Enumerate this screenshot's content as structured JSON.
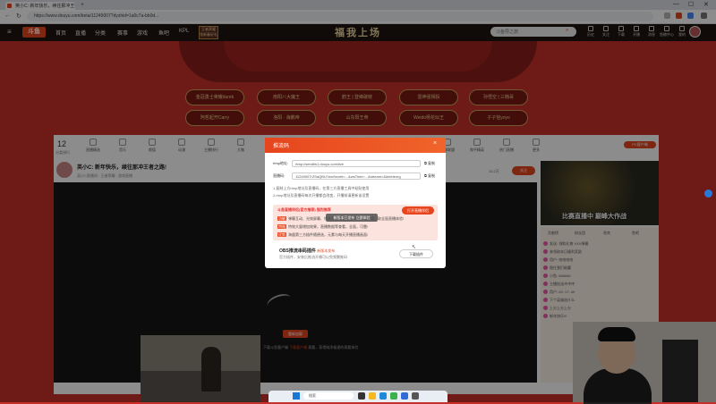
{
  "browser": {
    "tab_title": "英小C: 新年快乐，续往那冲王者之路 - 斗鱼",
    "new_tab": "+",
    "url": "https://www.douyu.com/beta/11249007?dyshid=1a0c7a-bb0d...",
    "win_controls": [
      "—",
      "☐",
      "✕"
    ]
  },
  "header": {
    "logo": "斗鱼",
    "menu_icon": "≡",
    "nav": [
      "首页",
      "直播",
      "分类",
      "赛事",
      "游戏",
      "鱼吧",
      "KPL"
    ],
    "promo": [
      "王者荣耀",
      "领新春好礼"
    ],
    "banner_title": "福我上场",
    "search_placeholder": "斗鱼导之旅",
    "icons": [
      "历史",
      "关注",
      "下载",
      "开播",
      "消息",
      "鱼粮中心",
      "我的"
    ]
  },
  "event_pills": [
    [
      "金冠勇士荣耀dumb",
      "南阳八大魔王",
      "鹤王 | 登峰破晓",
      "雷神强相投",
      "孙悟空 | 三韩哥"
    ],
    [
      "阿哲起开Carry",
      "洛阳 · 海鹏帝",
      "山东阳王帝",
      "Weido杨花似王",
      "子子恰yoyo"
    ]
  ],
  "categories": {
    "count": "12",
    "count_label": "分类排行",
    "items": [
      "直播精选",
      "音乐",
      "颜值",
      "动漫",
      "主播排行",
      "大咖",
      "娱乐",
      "赛事直播",
      "星秀",
      "相亲交友",
      "恋爱",
      "陪玩",
      "英雄联盟",
      "和平精英",
      "热门直播",
      "更多"
    ],
    "pc_badge": "PC客户端"
  },
  "streamer": {
    "name": "英小C: 新年快乐，续往那冲王者之路!",
    "sub": "英小C直播间 · 王者荣耀 · 游戏直播",
    "follow": "关注",
    "fans": "10.2万"
  },
  "player": {
    "open_button": "重新加载",
    "hint_prefix": "下载斗鱼客户端",
    "hint_highlight": "下载客户端",
    "hint_suffix": "观看，获得纯净极速的观看体验"
  },
  "right": {
    "mini_text": "比赛直播中 巅峰大作战",
    "chat_tabs": [
      "贡献榜",
      "粉丝团",
      "贵宾",
      "鱼吧"
    ],
    "chat_rows": [
      "发送: 领取礼物 XXX弹幕",
      "来领取本日福利奖励",
      "用户: 哈哈哈哈",
      "稳住我们能赢",
      "小鱼: 666666",
      "主播加油冲冲冲",
      "用户: 00: 17: 49",
      "下个英雄选什么",
      "上分上分上分",
      "新年快乐!!!"
    ]
  },
  "modal": {
    "title": "推流码",
    "close": "×",
    "rtmp_label": "rtmp地址:",
    "rtmp_value": "rtmp://sendfw1.douyu.com/live",
    "code_label": "直播码:",
    "code_value": "11249007rZSaQBU?wsSecret=...&wsTime=...&stream=&deleteorg",
    "copy": "复制",
    "notes": [
      "1.复制上方rtmp地址及直播码，在第三方直播工具中粘贴使用",
      "2.rtmp地址及直播码每次开播都会改变，开播前请更新该设置"
    ],
    "warn_title": "斗鱼直播伴侣(官方推荐) 强烈推荐",
    "tooltip": "新版本已发布 立即体验",
    "download_btn1": "打开直播伴侣",
    "warn_tags": [
      "功能",
      "特效",
      "优势"
    ],
    "warn_lines": [
      "弹幕互动、光效屏幕、特效礼物等主播工具，一键开播，取全面直播体验!",
      "特效大量增加效果，直播数据等查看，全面，可靠!",
      "海量第三方插件随便选，元素与每天开播直播画面!"
    ],
    "obs_title": "OBS推流串码插件",
    "obs_tag": "新版本发布",
    "obs_sub": "官方插件，安装后推流开播可以免频繁推码",
    "download_btn2": "下载插件"
  },
  "taskbar": {
    "search": "搜索"
  }
}
